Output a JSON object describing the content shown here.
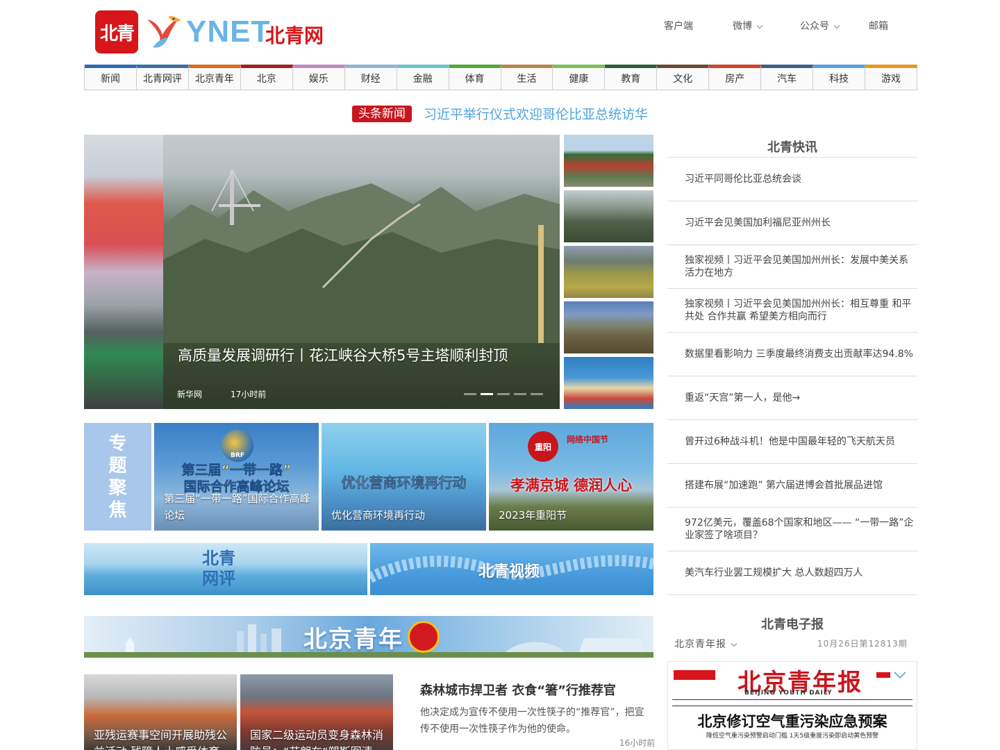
{
  "header": {
    "logo_text": "北青",
    "brand_en": "YNET",
    "brand_cn": "北青网",
    "links": [
      {
        "label": "客户端",
        "dropdown": false
      },
      {
        "label": "微博",
        "dropdown": true
      },
      {
        "label": "公众号",
        "dropdown": true
      },
      {
        "label": "邮箱",
        "dropdown": false
      }
    ]
  },
  "nav": {
    "items": [
      {
        "label": "新闻",
        "color": "#2e6db4"
      },
      {
        "label": "北青网评",
        "color": "#3d6ea5"
      },
      {
        "label": "北京青年",
        "color": "#e06a1b"
      },
      {
        "label": "北京",
        "color": "#a61e1e"
      },
      {
        "label": "娱乐",
        "color": "#c08ac0"
      },
      {
        "label": "财经",
        "color": "#8fb5d9"
      },
      {
        "label": "金融",
        "color": "#6cc3c9"
      },
      {
        "label": "体育",
        "color": "#52a83a"
      },
      {
        "label": "生活",
        "color": "#b8864f"
      },
      {
        "label": "健康",
        "color": "#7cc05a"
      },
      {
        "label": "教育",
        "color": "#2e5d3a"
      },
      {
        "label": "文化",
        "color": "#6b4a2f"
      },
      {
        "label": "房产",
        "color": "#d3432a"
      },
      {
        "label": "汽车",
        "color": "#3e5f8a"
      },
      {
        "label": "科技",
        "color": "#5aa0dd"
      },
      {
        "label": "游戏",
        "color": "#e39a1e"
      }
    ]
  },
  "headline": {
    "badge": "头条新闻",
    "text": "习近平举行仪式欢迎哥伦比亚总统访华"
  },
  "carousel": {
    "title": "高质量发展调研行丨花江峡谷大桥5号主塔顺利封顶",
    "source": "新华网",
    "time": "17小时前",
    "active_index": 1,
    "slide_count": 5
  },
  "kuaixun": {
    "title": "北青快讯",
    "items": [
      "习近平同哥伦比亚总统会谈",
      "习近平会见美国加利福尼亚州州长",
      "独家视频丨习近平会见美国加州州长：发展中美关系活力在地方",
      "独家视频丨习近平会见美国加州州长：相互尊重 和平共处 合作共赢 希望美方相向而行",
      "数据里看影响力 三季度最终消费支出贡献率达94.8%",
      "重返“天宫”第一人，是他→",
      "曾开过6种战斗机！他是中国最年轻的飞天航天员",
      "搭建布展“加速跑” 第六届进博会首批展品进馆",
      "972亿美元，覆盖68个国家和地区—— “一带一路”企业家签了啥项目？",
      "美汽车行业罢工规模扩大 总人数超四万人"
    ]
  },
  "topics": {
    "label": [
      "专",
      "题",
      "聚",
      "焦"
    ],
    "items": [
      {
        "big": "第三届“一带一路”\n国际合作高峰论坛",
        "badge": "BRF",
        "caption": "第三届“一带一路”国际合作高峰论坛"
      },
      {
        "big": "优化营商环境再行动",
        "caption": "优化营商环境再行动"
      },
      {
        "big": "孝满京城 德润人心",
        "seal": "重阳",
        "seal2": "网络中国节",
        "caption": "2023年重阳节"
      }
    ]
  },
  "banners": {
    "pinglun": "北青\n网评",
    "video": "北青视频"
  },
  "bqyouth": {
    "banner_text": "北京青年",
    "news": [
      {
        "caption": "亚残运赛事空间开展助残公益活动 残障人士感受体育"
      },
      {
        "caption": "国家二级运动员变身森林消防员：“节朗在“塑斯图清"
      }
    ],
    "story": {
      "title": "森林城市捍卫者 衣食“箸”行推荐官",
      "desc": "他决定成为宣传不使用一次性筷子的“推荐官”，把宣传不使用一次性筷子作为他的使命。",
      "time": "16小时前"
    }
  },
  "epaper": {
    "title": "北青电子报",
    "selector": "北京青年报",
    "date": "10月26日第12813期",
    "masthead": "北京青年报",
    "masthead_en": "BEIJING YOUTH DAILY",
    "headline": "北京修订空气重污染应急预案",
    "subhead": "降低空气重污染预警启动门槛 1天5级重度污染即启动黄色预警"
  }
}
